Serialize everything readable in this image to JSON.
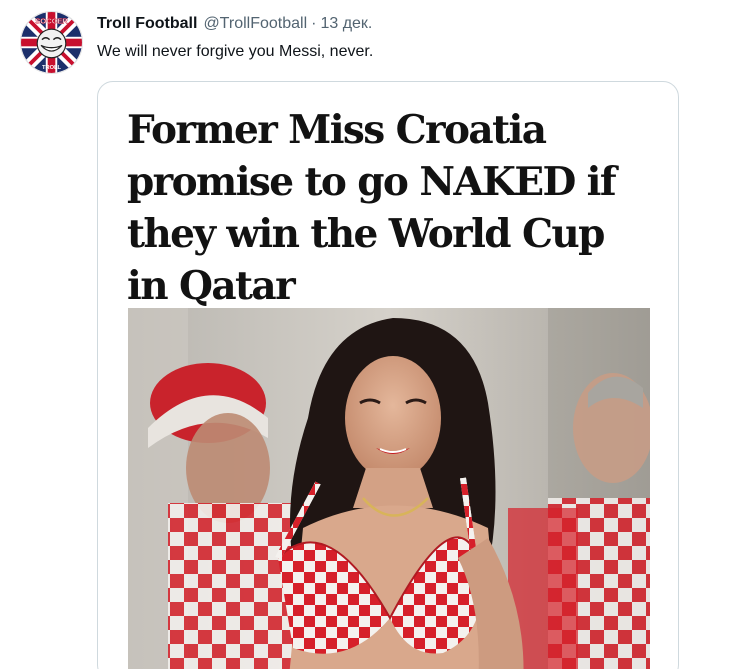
{
  "tweet": {
    "author_name": "Troll Football",
    "author_handle": "@TrollFootball",
    "separator": "·",
    "timestamp": "13 дек.",
    "text": "We will never forgive you Messi, never.",
    "avatar_icon": "troll-face-union-jack-logo",
    "avatar_badge_text_top": "SOCCER",
    "avatar_badge_text_bottom": "TROLL"
  },
  "article": {
    "headline": "Former Miss Croatia promise to go NAKED if they win the World Cup in Qatar",
    "photo_description_icon": "woman-croatia-checkered-outfit-photo"
  },
  "colors": {
    "text_primary": "#0f1419",
    "text_secondary": "#536471",
    "card_border": "#cfd9de",
    "croatia_red": "#d6202a"
  }
}
